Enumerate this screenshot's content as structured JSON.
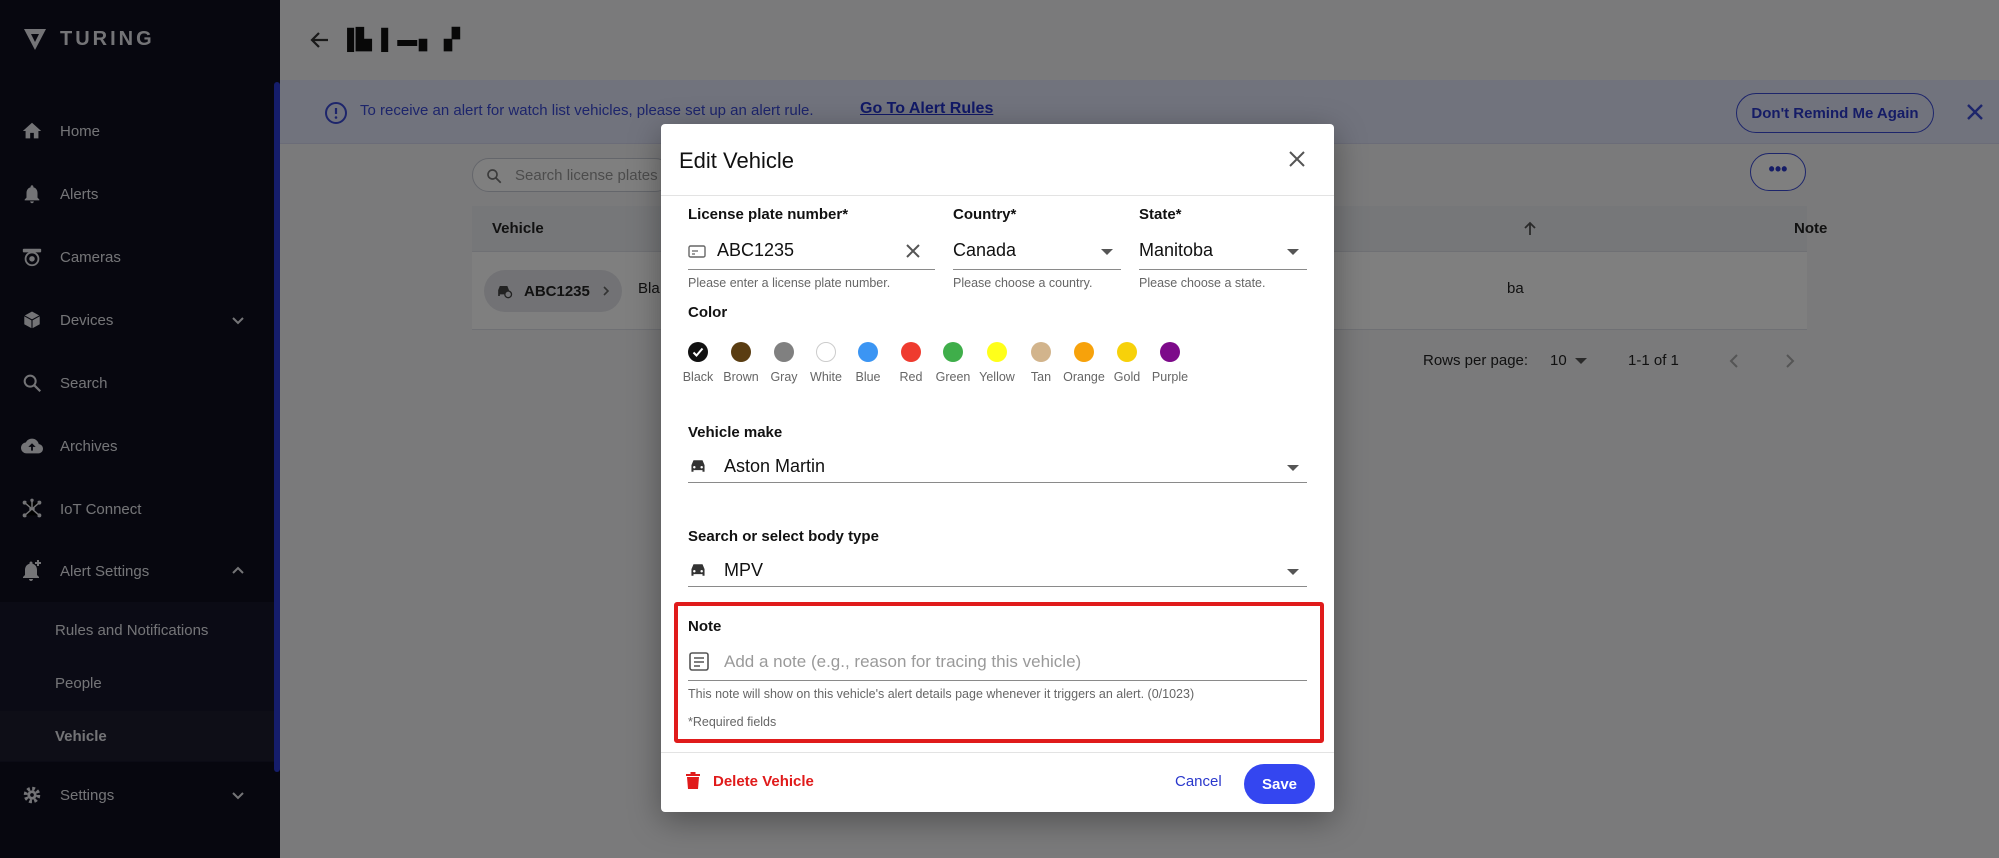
{
  "sidebar": {
    "brand": "TURING",
    "items": [
      {
        "label": "Home",
        "icon": "home-icon"
      },
      {
        "label": "Alerts",
        "icon": "bell-icon"
      },
      {
        "label": "Cameras",
        "icon": "camera-icon"
      },
      {
        "label": "Devices",
        "icon": "cube-icon"
      },
      {
        "label": "Search",
        "icon": "search-icon"
      },
      {
        "label": "Archives",
        "icon": "cloud-upload-icon"
      },
      {
        "label": "IoT Connect",
        "icon": "hub-icon"
      },
      {
        "label": "Alert Settings",
        "icon": "bell-plus-icon"
      },
      {
        "label": "Settings",
        "icon": "gear-icon"
      }
    ],
    "sub_items": [
      {
        "label": "Rules and Notifications"
      },
      {
        "label": "People"
      },
      {
        "label": "Vehicle",
        "active": true
      }
    ]
  },
  "header": {
    "title_glyphs": "▐▙ ▌▬▖ ▞"
  },
  "banner": {
    "message": "To receive an alert for watch list vehicles, please set up an alert rule.",
    "link": "Go To Alert Rules",
    "remind_button": "Don't Remind Me Again"
  },
  "table": {
    "search_placeholder": "Search license plates",
    "more_label": "•••",
    "columns": [
      "Vehicle",
      "Note"
    ],
    "row": {
      "plate": "ABC1235",
      "color_fragment": "Bla",
      "state_fragment": "ba"
    },
    "rows_per_page_label": "Rows per page:",
    "rows_per_page": "10",
    "range": "1-1 of 1"
  },
  "dialog": {
    "title": "Edit Vehicle",
    "license": {
      "label": "License plate number*",
      "value": "ABC1235",
      "helper": "Please enter a license plate number."
    },
    "country": {
      "label": "Country*",
      "value": "Canada",
      "helper": "Please choose a country."
    },
    "state": {
      "label": "State*",
      "value": "Manitoba",
      "helper": "Please choose a state."
    },
    "color": {
      "label": "Color",
      "selected": "Black",
      "swatches": [
        {
          "name": "Black",
          "hex": "#111111"
        },
        {
          "name": "Brown",
          "hex": "#5a3d12"
        },
        {
          "name": "Gray",
          "hex": "#808080"
        },
        {
          "name": "White",
          "hex": "#ffffff"
        },
        {
          "name": "Blue",
          "hex": "#3b95f3"
        },
        {
          "name": "Red",
          "hex": "#ef3b2f"
        },
        {
          "name": "Green",
          "hex": "#3fae4a"
        },
        {
          "name": "Yellow",
          "hex": "#ffff1a"
        },
        {
          "name": "Tan",
          "hex": "#d2b48c"
        },
        {
          "name": "Orange",
          "hex": "#f7a20b"
        },
        {
          "name": "Gold",
          "hex": "#f7d10a"
        },
        {
          "name": "Purple",
          "hex": "#7d0a8a"
        }
      ]
    },
    "make": {
      "label": "Vehicle make",
      "value": "Aston Martin"
    },
    "body": {
      "label": "Search or select body type",
      "value": "MPV"
    },
    "note": {
      "label": "Note",
      "placeholder": "Add a note (e.g., reason for tracing this vehicle)",
      "helper": "This note will show on this vehicle's alert details page whenever it triggers an alert. (0/1023)",
      "required": "*Required fields"
    },
    "delete_label": "Delete Vehicle",
    "cancel_label": "Cancel",
    "save_label": "Save"
  },
  "colors": {
    "accent": "#3446f0",
    "danger": "#e01b1b",
    "sidebar_bg": "#0e0f1f"
  }
}
